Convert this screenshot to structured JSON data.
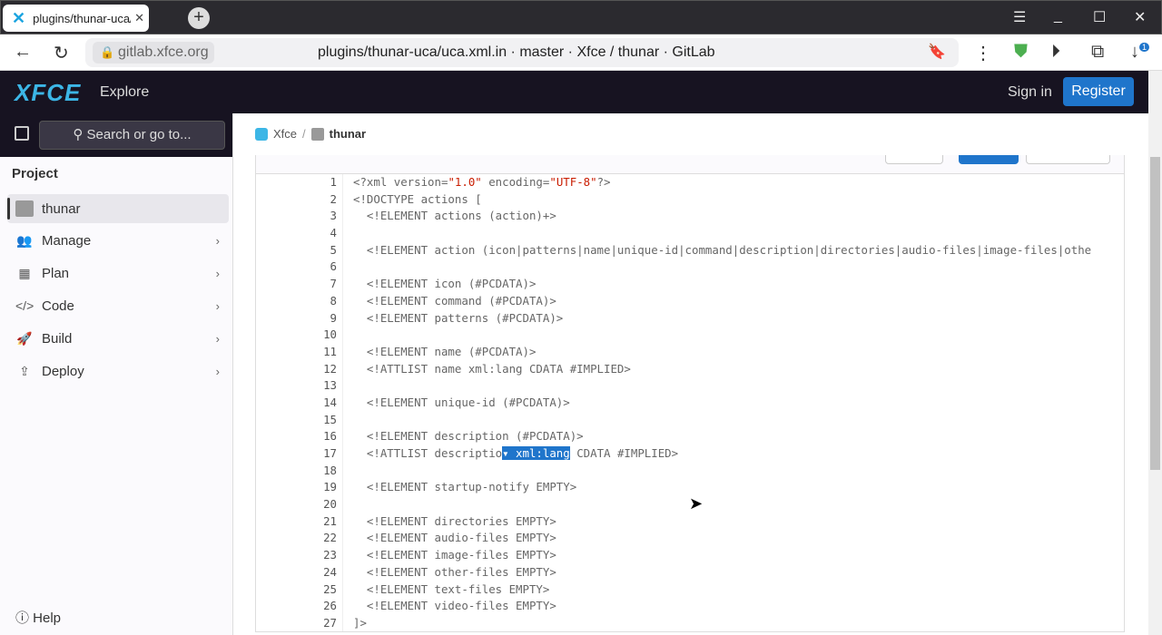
{
  "browser": {
    "tab_title": "plugins/thunar-uca/uca.xml.in · master · Xfce / thunar · GitLab",
    "tab_title_visible": "plugins/thunar-uca/uca",
    "domain": "gitlab.xfce.org",
    "page_title": "plugins/thunar-uca/uca.xml.in · master · Xfce / thunar · GitLab",
    "downloads_badge": "1"
  },
  "header": {
    "logo": "XFCE",
    "explore": "Explore",
    "sign_in": "Sign in",
    "register": "Register"
  },
  "sidebar": {
    "search_placeholder": "Search or go to...",
    "section": "Project",
    "items": [
      {
        "label": "thunar",
        "icon": "project-icon",
        "active": true
      },
      {
        "label": "Manage",
        "icon": "users-icon"
      },
      {
        "label": "Plan",
        "icon": "calendar-icon"
      },
      {
        "label": "Code",
        "icon": "code-icon"
      },
      {
        "label": "Build",
        "icon": "rocket-icon"
      },
      {
        "label": "Deploy",
        "icon": "deploy-icon"
      }
    ],
    "help": "Help"
  },
  "breadcrumb": [
    "Xfce",
    "/",
    "thunar"
  ],
  "code": {
    "selected_tooltip": "▾ xml:lang",
    "lines": [
      "<?xml version=\"1.0\" encoding=\"UTF-8\"?>",
      "<!DOCTYPE actions [",
      "  <!ELEMENT actions (action)+>",
      "",
      "  <!ELEMENT action (icon|patterns|name|unique-id|command|description|directories|audio-files|image-files|othe",
      "",
      "  <!ELEMENT icon (#PCDATA)>",
      "  <!ELEMENT command (#PCDATA)>",
      "  <!ELEMENT patterns (#PCDATA)>",
      "",
      "  <!ELEMENT name (#PCDATA)>",
      "  <!ATTLIST name xml:lang CDATA #IMPLIED>",
      "",
      "  <!ELEMENT unique-id (#PCDATA)>",
      "",
      "  <!ELEMENT description (#PCDATA)>",
      "  <!ATTLIST descriptio",
      "",
      "  <!ELEMENT startup-notify EMPTY>",
      "",
      "  <!ELEMENT directories EMPTY>",
      "  <!ELEMENT audio-files EMPTY>",
      "  <!ELEMENT image-files EMPTY>",
      "  <!ELEMENT other-files EMPTY>",
      "  <!ELEMENT text-files EMPTY>",
      "  <!ELEMENT video-files EMPTY>",
      "]>"
    ],
    "line17_rest": " CDATA #IMPLIED>"
  },
  "colors": {
    "accent": "#1f75cb",
    "header_bg": "#171321",
    "string": "#c91c00"
  }
}
